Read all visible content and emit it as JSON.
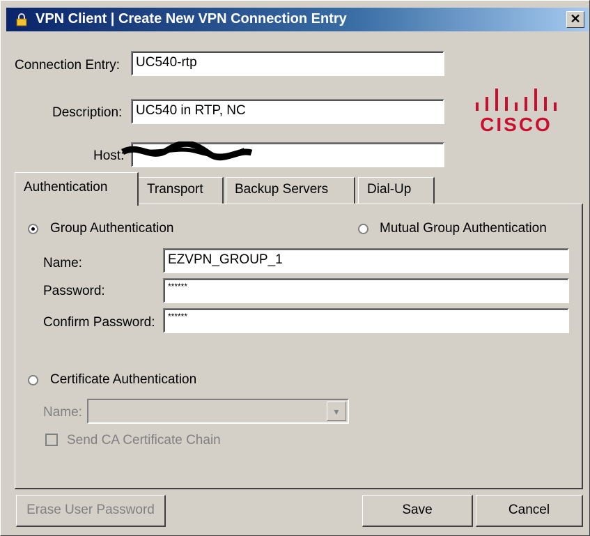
{
  "window": {
    "title": "VPN Client  |  Create New VPN Connection Entry",
    "close_glyph": "✕"
  },
  "form": {
    "connection_entry_label": "Connection Entry:",
    "connection_entry_value": "UC540-rtp",
    "description_label": "Description:",
    "description_value": "UC540 in RTP, NC",
    "host_label": "Host:",
    "host_value": ""
  },
  "logo": {
    "text": "CISCO"
  },
  "tabs": [
    {
      "label": "Authentication",
      "active": true
    },
    {
      "label": "Transport",
      "active": false
    },
    {
      "label": "Backup Servers",
      "active": false
    },
    {
      "label": "Dial-Up",
      "active": false
    }
  ],
  "auth": {
    "group_auth_label": "Group Authentication",
    "group_auth_selected": true,
    "mutual_group_auth_label": "Mutual Group Authentication",
    "mutual_group_auth_selected": false,
    "name_label": "Name:",
    "name_value": "EZVPN_GROUP_1",
    "password_label": "Password:",
    "password_value": "******",
    "confirm_password_label": "Confirm Password:",
    "confirm_password_value": "******",
    "cert_auth_label": "Certificate Authentication",
    "cert_auth_selected": false,
    "cert_name_label": "Name:",
    "cert_name_value": "",
    "send_ca_chain_label": "Send CA Certificate Chain",
    "send_ca_chain_checked": false
  },
  "buttons": {
    "erase_password": "Erase User Password",
    "save": "Save",
    "cancel": "Cancel"
  },
  "colors": {
    "title_bar": "#0a246a",
    "dialog_bg": "#d4d0c8",
    "cisco_red": "#c8102e"
  }
}
